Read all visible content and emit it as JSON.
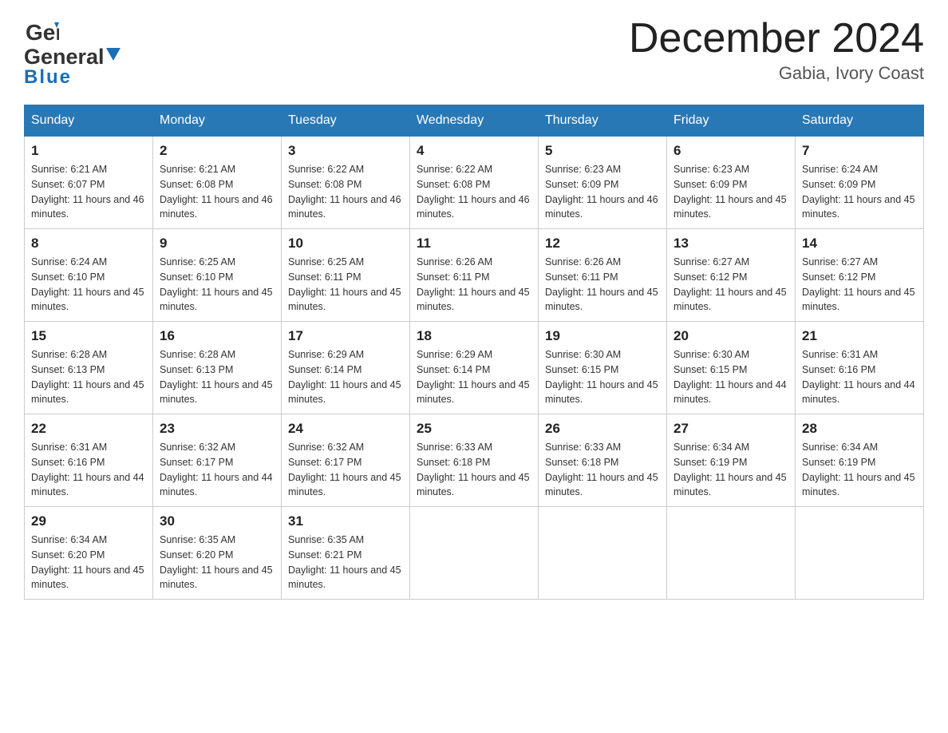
{
  "header": {
    "logo_general": "General",
    "logo_blue": "Blue",
    "month_title": "December 2024",
    "location": "Gabia, Ivory Coast"
  },
  "weekdays": [
    "Sunday",
    "Monday",
    "Tuesday",
    "Wednesday",
    "Thursday",
    "Friday",
    "Saturday"
  ],
  "weeks": [
    [
      {
        "day": "1",
        "sunrise": "6:21 AM",
        "sunset": "6:07 PM",
        "daylight": "11 hours and 46 minutes."
      },
      {
        "day": "2",
        "sunrise": "6:21 AM",
        "sunset": "6:08 PM",
        "daylight": "11 hours and 46 minutes."
      },
      {
        "day": "3",
        "sunrise": "6:22 AM",
        "sunset": "6:08 PM",
        "daylight": "11 hours and 46 minutes."
      },
      {
        "day": "4",
        "sunrise": "6:22 AM",
        "sunset": "6:08 PM",
        "daylight": "11 hours and 46 minutes."
      },
      {
        "day": "5",
        "sunrise": "6:23 AM",
        "sunset": "6:09 PM",
        "daylight": "11 hours and 46 minutes."
      },
      {
        "day": "6",
        "sunrise": "6:23 AM",
        "sunset": "6:09 PM",
        "daylight": "11 hours and 45 minutes."
      },
      {
        "day": "7",
        "sunrise": "6:24 AM",
        "sunset": "6:09 PM",
        "daylight": "11 hours and 45 minutes."
      }
    ],
    [
      {
        "day": "8",
        "sunrise": "6:24 AM",
        "sunset": "6:10 PM",
        "daylight": "11 hours and 45 minutes."
      },
      {
        "day": "9",
        "sunrise": "6:25 AM",
        "sunset": "6:10 PM",
        "daylight": "11 hours and 45 minutes."
      },
      {
        "day": "10",
        "sunrise": "6:25 AM",
        "sunset": "6:11 PM",
        "daylight": "11 hours and 45 minutes."
      },
      {
        "day": "11",
        "sunrise": "6:26 AM",
        "sunset": "6:11 PM",
        "daylight": "11 hours and 45 minutes."
      },
      {
        "day": "12",
        "sunrise": "6:26 AM",
        "sunset": "6:11 PM",
        "daylight": "11 hours and 45 minutes."
      },
      {
        "day": "13",
        "sunrise": "6:27 AM",
        "sunset": "6:12 PM",
        "daylight": "11 hours and 45 minutes."
      },
      {
        "day": "14",
        "sunrise": "6:27 AM",
        "sunset": "6:12 PM",
        "daylight": "11 hours and 45 minutes."
      }
    ],
    [
      {
        "day": "15",
        "sunrise": "6:28 AM",
        "sunset": "6:13 PM",
        "daylight": "11 hours and 45 minutes."
      },
      {
        "day": "16",
        "sunrise": "6:28 AM",
        "sunset": "6:13 PM",
        "daylight": "11 hours and 45 minutes."
      },
      {
        "day": "17",
        "sunrise": "6:29 AM",
        "sunset": "6:14 PM",
        "daylight": "11 hours and 45 minutes."
      },
      {
        "day": "18",
        "sunrise": "6:29 AM",
        "sunset": "6:14 PM",
        "daylight": "11 hours and 45 minutes."
      },
      {
        "day": "19",
        "sunrise": "6:30 AM",
        "sunset": "6:15 PM",
        "daylight": "11 hours and 45 minutes."
      },
      {
        "day": "20",
        "sunrise": "6:30 AM",
        "sunset": "6:15 PM",
        "daylight": "11 hours and 44 minutes."
      },
      {
        "day": "21",
        "sunrise": "6:31 AM",
        "sunset": "6:16 PM",
        "daylight": "11 hours and 44 minutes."
      }
    ],
    [
      {
        "day": "22",
        "sunrise": "6:31 AM",
        "sunset": "6:16 PM",
        "daylight": "11 hours and 44 minutes."
      },
      {
        "day": "23",
        "sunrise": "6:32 AM",
        "sunset": "6:17 PM",
        "daylight": "11 hours and 44 minutes."
      },
      {
        "day": "24",
        "sunrise": "6:32 AM",
        "sunset": "6:17 PM",
        "daylight": "11 hours and 45 minutes."
      },
      {
        "day": "25",
        "sunrise": "6:33 AM",
        "sunset": "6:18 PM",
        "daylight": "11 hours and 45 minutes."
      },
      {
        "day": "26",
        "sunrise": "6:33 AM",
        "sunset": "6:18 PM",
        "daylight": "11 hours and 45 minutes."
      },
      {
        "day": "27",
        "sunrise": "6:34 AM",
        "sunset": "6:19 PM",
        "daylight": "11 hours and 45 minutes."
      },
      {
        "day": "28",
        "sunrise": "6:34 AM",
        "sunset": "6:19 PM",
        "daylight": "11 hours and 45 minutes."
      }
    ],
    [
      {
        "day": "29",
        "sunrise": "6:34 AM",
        "sunset": "6:20 PM",
        "daylight": "11 hours and 45 minutes."
      },
      {
        "day": "30",
        "sunrise": "6:35 AM",
        "sunset": "6:20 PM",
        "daylight": "11 hours and 45 minutes."
      },
      {
        "day": "31",
        "sunrise": "6:35 AM",
        "sunset": "6:21 PM",
        "daylight": "11 hours and 45 minutes."
      },
      null,
      null,
      null,
      null
    ]
  ]
}
